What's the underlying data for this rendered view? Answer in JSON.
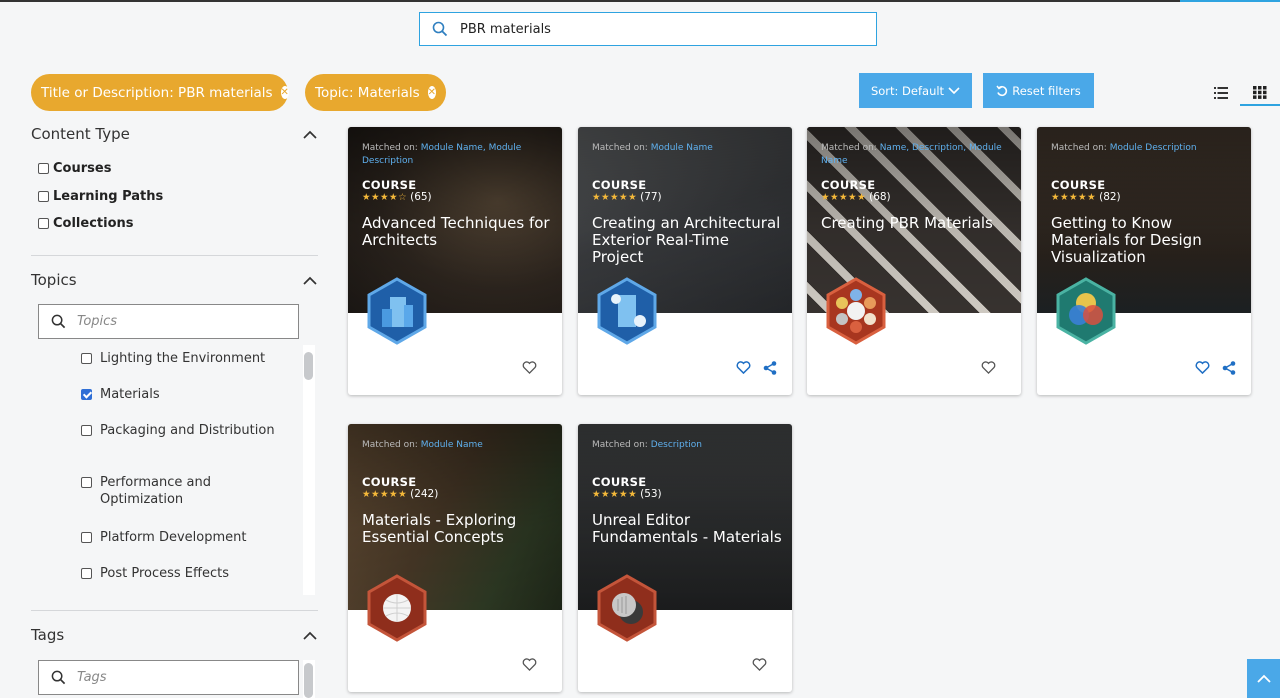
{
  "search": {
    "value": "PBR materials"
  },
  "chips": [
    {
      "label": "Title or Description: PBR materials"
    },
    {
      "label": "Topic: Materials"
    }
  ],
  "toolbar": {
    "sort_label": "Sort: Default",
    "reset_label": "Reset filters"
  },
  "sidebar": {
    "content_type": {
      "title": "Content Type",
      "items": [
        {
          "label": "Courses"
        },
        {
          "label": "Learning Paths"
        },
        {
          "label": "Collections"
        }
      ]
    },
    "topics": {
      "title": "Topics",
      "placeholder": "Topics",
      "items": [
        {
          "label": "Lighting the Environment",
          "checked": false
        },
        {
          "label": "Materials",
          "checked": true
        },
        {
          "label": "Packaging and Distribution",
          "checked": false
        },
        {
          "label": "Performance and Optimization",
          "checked": false
        },
        {
          "label": "Platform Development",
          "checked": false
        },
        {
          "label": "Post Process Effects",
          "checked": false
        }
      ]
    },
    "tags": {
      "title": "Tags",
      "placeholder": "Tags"
    }
  },
  "cards": [
    {
      "matched_prefix": "Matched on:",
      "matched": "Module Name, Module Description",
      "kind": "COURSE",
      "stars": "★★★★☆",
      "count": "(65)",
      "title": "Advanced Techniques for Architects",
      "icons": [
        "heart-icon"
      ]
    },
    {
      "matched_prefix": "Matched on:",
      "matched": "Module Name",
      "kind": "COURSE",
      "stars": "★★★★★",
      "count": "(77)",
      "title": "Creating an Architectural Exterior Real-Time Project",
      "icons": [
        "heart-icon",
        "share-icon"
      ]
    },
    {
      "matched_prefix": "Matched on:",
      "matched": "Name, Description, Module Name",
      "kind": "COURSE",
      "stars": "★★★★★",
      "count": "(68)",
      "title": "Creating PBR Materials",
      "icons": [
        "heart-icon"
      ]
    },
    {
      "matched_prefix": "Matched on:",
      "matched": "Module Description",
      "kind": "COURSE",
      "stars": "★★★★★",
      "count": "(82)",
      "title": "Getting to Know Materials for Design Visualization",
      "icons": [
        "heart-icon",
        "share-icon"
      ]
    },
    {
      "matched_prefix": "Matched on:",
      "matched": "Module Name",
      "kind": "COURSE",
      "stars": "★★★★★",
      "count": "(242)",
      "title": "Materials - Exploring Essential Concepts",
      "icons": [
        "heart-icon"
      ]
    },
    {
      "matched_prefix": "Matched on:",
      "matched": "Description",
      "kind": "COURSE",
      "stars": "★★★★★",
      "count": "(53)",
      "title": "Unreal Editor Fundamentals - Materials",
      "icons": [
        "heart-icon"
      ]
    }
  ],
  "colors": {
    "accent": "#2ea3e0",
    "chip": "#e8a82e",
    "button": "#4aa8e8",
    "star": "#f5b93a"
  }
}
